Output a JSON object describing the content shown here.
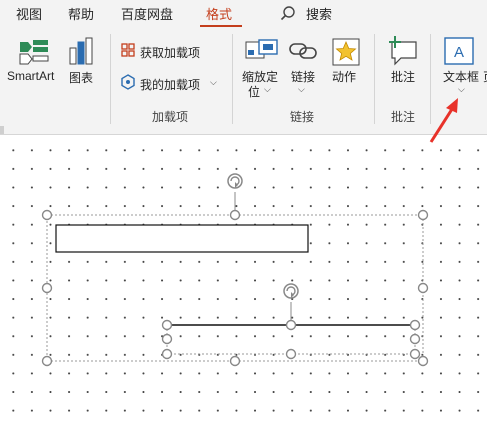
{
  "tabs": [
    {
      "label": "视图",
      "active": false
    },
    {
      "label": "帮助",
      "active": false
    },
    {
      "label": "百度网盘",
      "active": false
    },
    {
      "label": "格式",
      "active": true
    }
  ],
  "search": {
    "label": "搜索",
    "icon": "search-icon"
  },
  "groups": {
    "insert": {
      "smartart_label": "SmartArt",
      "chart_label": "图表"
    },
    "addins": {
      "get_addins_label": "获取加载项",
      "my_addins_label": "我的加载项",
      "group_label": "加载项"
    },
    "links": {
      "zoom_label_line1": "缩放定",
      "zoom_label_line2": "位",
      "link_label": "链接",
      "action_label": "动作",
      "group_label": "链接"
    },
    "comments": {
      "comment_label": "批注",
      "group_label": "批注"
    },
    "text": {
      "textbox_label": "文本框",
      "cut_off_label": "页"
    }
  },
  "colors": {
    "accent": "#c43e1c",
    "arrow": "#e8322a",
    "icon_blue": "#2b6cb0",
    "icon_green": "#2e8b57"
  }
}
